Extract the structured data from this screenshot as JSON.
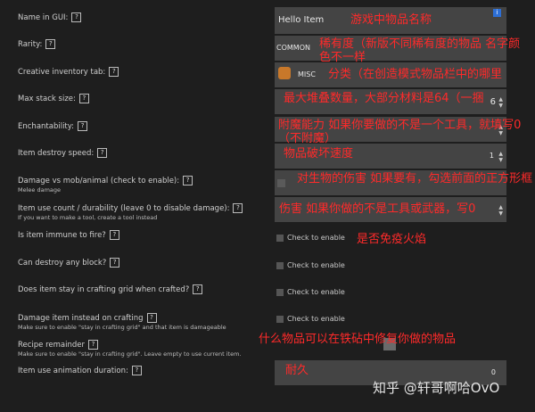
{
  "help_glyph": "?",
  "rows": [
    {
      "label": "Name in GUI:"
    },
    {
      "label": "Rarity:"
    },
    {
      "label": "Creative inventory tab:"
    },
    {
      "label": "Max stack size:"
    },
    {
      "label": "Enchantability:"
    },
    {
      "label": "Item destroy speed:"
    },
    {
      "label": "Damage vs mob/animal (check to enable):",
      "sub": "Melee damage"
    },
    {
      "label": "Item use count / durability (leave 0 to disable damage):",
      "sub": "If you want to make a tool, create a tool instead"
    },
    {
      "label": "Is item immune to fire?"
    },
    {
      "label": "Can destroy any block?"
    },
    {
      "label": "Does item stay in crafting grid when crafted?"
    },
    {
      "label": "Damage item instead on crafting",
      "sub": "Make sure to enable \"stay in crafting grid\" and that item is damageable"
    },
    {
      "label": "Recipe remainder",
      "sub": "Make sure to enable \"stay in crafting grid\". Leave empty to use current item."
    },
    {
      "label": "Item use animation duration:"
    }
  ],
  "fields": {
    "name_value": "Hello Item",
    "rarity_value": "COMMON",
    "tab_value": "MISC",
    "stack_value": "6",
    "destroy_speed_value": "1",
    "animation_value": "0",
    "check_label": "Check to enable",
    "info_glyph": "i"
  },
  "annotations": {
    "name": "游戏中物品名称",
    "rarity": "稀有度（新版不同稀有度的物品 名字颜色不一样",
    "tab": "分类（在创造模式物品栏中的哪里",
    "stack": "最大堆叠数量，大部分材料是64（一捆",
    "enchant": "附魔能力 如果你要做的不是一个工具，就填写0（不附魔）",
    "destroy": "物品破坏速度",
    "damage": "对生物的伤害 如果要有，勾选前面的正方形框",
    "durability": "伤害 如果你做的不是工具或武器，写0",
    "fire": "是否免疫火焰",
    "remainder": "什么物品可以在铁砧中修复你做的物品",
    "durability2": "耐久"
  },
  "watermark": "知乎 @轩哥啊哈OvO"
}
